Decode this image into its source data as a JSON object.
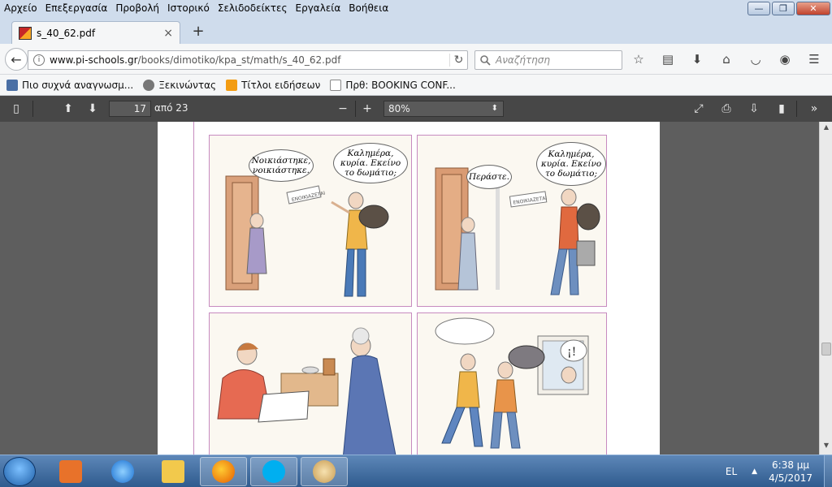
{
  "menubar": {
    "items": [
      "Αρχείο",
      "Επεξεργασία",
      "Προβολή",
      "Ιστορικό",
      "Σελιδοδείκτες",
      "Εργαλεία",
      "Βοήθεια"
    ]
  },
  "window_controls": {
    "minimize": "—",
    "maximize": "❐",
    "close": "✕"
  },
  "tab": {
    "title": "s_40_62.pdf",
    "close": "×",
    "new_tab": "+"
  },
  "navbar": {
    "back": "←",
    "url_domain": "www.pi-schools.gr",
    "url_path": "/books/dimotiko/kpa_st/math/s_40_62.pdf",
    "reload": "↻",
    "search_placeholder": "Αναζήτηση"
  },
  "bookmarks": [
    {
      "label": "Πιο συχνά αναγνωσμ...",
      "icon": "most-visited-icon",
      "color": "#4a6fa5"
    },
    {
      "label": "Ξεκινώντας",
      "icon": "globe-icon",
      "color": "#777777"
    },
    {
      "label": "Τίτλοι ειδήσεων",
      "icon": "rss-icon",
      "color": "#f39c12"
    },
    {
      "label": "Πρθ: BOOKING CONF...",
      "icon": "envelope-icon",
      "color": "#888888"
    }
  ],
  "pdf_toolbar": {
    "page_number": "17",
    "page_count": "από 23",
    "zoom": "80%",
    "zoom_out": "−",
    "zoom_in": "+"
  },
  "comic": {
    "panel1": {
      "bubble_left": "Νοικιάστηκε, νοικιάστηκε.",
      "bubble_right": "Καλημέρα, κυρία. Εκείνο το δωμάτιο;",
      "sign": "ΕΝΟΙΚΙΑΖΕΤΑΙ"
    },
    "panel2": {
      "bubble_left": "Περάστε.",
      "bubble_right": "Καλημέρα, κυρία. Εκείνο το δωμάτιο;",
      "sign": "ΕΝΟΙΚΙΑΖΕΤΑΙ"
    },
    "panel4": {
      "exclaim": "¡!"
    }
  },
  "taskbar": {
    "language": "EL",
    "time": "6:38 μμ",
    "date": "4/5/2017",
    "tray_arrow": "▲"
  },
  "colors": {
    "pdf_toolbar_bg": "#474747",
    "viewer_bg": "#5e5e5e",
    "panel_border": "#c78bc0"
  }
}
